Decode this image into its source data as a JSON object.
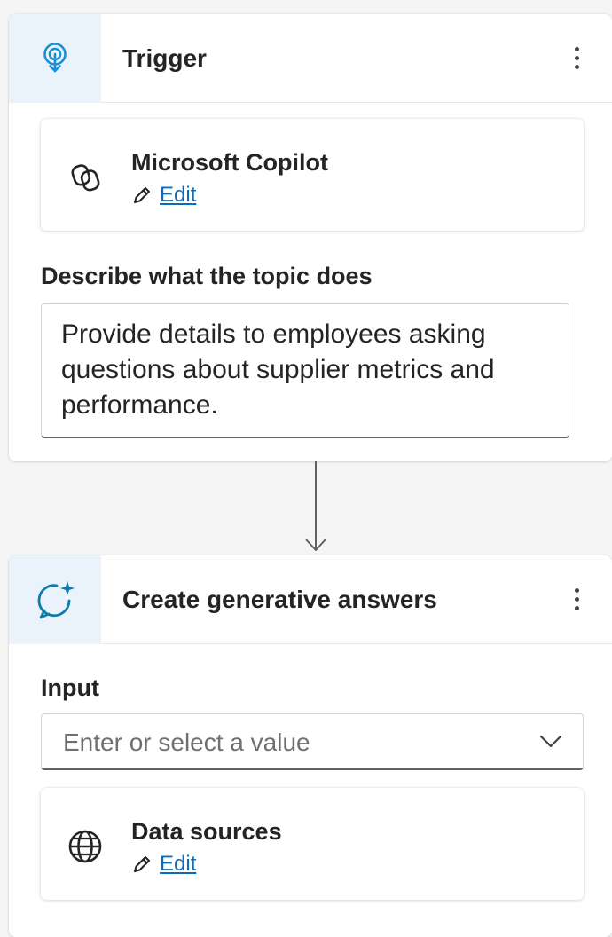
{
  "trigger": {
    "title": "Trigger",
    "icon": "trigger-icon",
    "source": {
      "title": "Microsoft Copilot",
      "icon": "copilot-icon",
      "edit_label": "Edit"
    },
    "description_label": "Describe what the topic does",
    "description_value": "Provide details to employees asking questions about supplier metrics and performance."
  },
  "generative": {
    "title": "Create generative answers",
    "icon": "sparkle-chat-icon",
    "input_label": "Input",
    "input_placeholder": "Enter or select a value",
    "data_sources": {
      "title": "Data sources",
      "icon": "globe-icon",
      "edit_label": "Edit"
    }
  },
  "colors": {
    "accent": "#0f6cbd",
    "icon_tile": "#eaf3fc",
    "trigger_icon": "#1a8fd6",
    "chat_icon": "#0f7ba8"
  }
}
